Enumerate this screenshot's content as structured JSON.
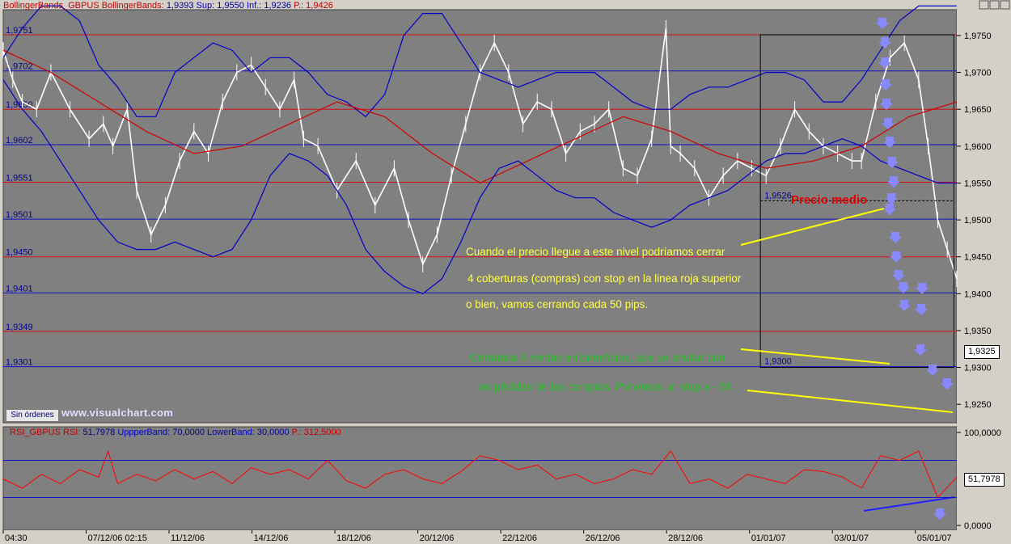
{
  "top_pane": {
    "header": {
      "name": "BollingerBands_GBPUS",
      "indicator": "BollingerBands:",
      "value": "1,9393",
      "sup_label": "Sup:",
      "sup_value": "1,9550",
      "inf_label": "Inf.:",
      "inf_value": "1,9236",
      "p_label": "P.:",
      "p_value": "1,9426"
    },
    "last_price": "1,9325",
    "order_button": "Sin órdenes",
    "watermark": "www.visualchart.com",
    "box_label_top": "1,9526",
    "box_label_bottom": "1,9300",
    "precio_medio": "Precio medio",
    "annotations": [
      "Cuando el precio llegue a este nivel podríamos cerrar",
      "4 coberturas (compras) con stop en la linea roja superior",
      "o bien, vamos cerrando cada 50 pips.",
      "Cerramos 4 ventas en beneficios, que se anulan con",
      "las pédidas de las compras. Ponemos un stop a - 50"
    ]
  },
  "bottom_pane": {
    "header": {
      "name": "RSI_GBPUS",
      "rsi_label": "RSI:",
      "rsi_value": "51,7978",
      "upper_label": "UppperBand:",
      "upper_value": "70,0000",
      "lower_label": "LowerBand:",
      "lower_value": "30,0000",
      "p_label": "P.:",
      "p_value": "312,5000"
    },
    "last_value": "51,7978"
  },
  "colors": {
    "background": "#808080",
    "blue_band": "#0000c8",
    "red_line": "#d00000",
    "yellow_line": "#ffff00",
    "annotation_yellow": "#ffff40",
    "annotation_green": "#20c020",
    "arrow": "#8888ff"
  },
  "chart_data": [
    {
      "type": "line",
      "pane": "price",
      "y_axis_ticks": [
        "1,9750",
        "1,9700",
        "1,9650",
        "1,9600",
        "1,9550",
        "1,9500",
        "1,9450",
        "1,9400",
        "1,9350",
        "1,9300",
        "1,9250"
      ],
      "ylim": [
        1.9225,
        1.9785
      ],
      "x_tick_labels": [
        "04:30",
        "07/12/06 02:15",
        "11/12/06",
        "14/12/06",
        "18/12/06",
        "20/12/06",
        "22/12/06",
        "26/12/06",
        "28/12/06",
        "01/01/07",
        "03/01/07",
        "05/01/07"
      ],
      "horizontal_levels": [
        {
          "label": "1,9751",
          "value": 1.9751,
          "color": "red"
        },
        {
          "label": "1,9702",
          "value": 1.9702,
          "color": "blue"
        },
        {
          "label": "1,9650",
          "value": 1.965,
          "color": "red"
        },
        {
          "label": "1,9602",
          "value": 1.9602,
          "color": "blue"
        },
        {
          "label": "1,9551",
          "value": 1.9551,
          "color": "red"
        },
        {
          "label": "1,9501",
          "value": 1.9501,
          "color": "blue"
        },
        {
          "label": "1,9450",
          "value": 1.945,
          "color": "red"
        },
        {
          "label": "1,9401",
          "value": 1.9401,
          "color": "blue"
        },
        {
          "label": "1,9349",
          "value": 1.9349,
          "color": "red"
        },
        {
          "label": "1,9301",
          "value": 1.9301,
          "color": "blue"
        }
      ],
      "series": [
        {
          "name": "price",
          "color": "#ffffff",
          "x": [
            0,
            0.01,
            0.02,
            0.035,
            0.05,
            0.07,
            0.09,
            0.105,
            0.115,
            0.13,
            0.14,
            0.155,
            0.17,
            0.185,
            0.2,
            0.215,
            0.23,
            0.245,
            0.26,
            0.275,
            0.29,
            0.305,
            0.315,
            0.33,
            0.35,
            0.37,
            0.39,
            0.41,
            0.425,
            0.44,
            0.455,
            0.47,
            0.485,
            0.5,
            0.515,
            0.53,
            0.545,
            0.56,
            0.575,
            0.59,
            0.605,
            0.62,
            0.635,
            0.65,
            0.665,
            0.68,
            0.695,
            0.7,
            0.71,
            0.725,
            0.74,
            0.755,
            0.77,
            0.785,
            0.8,
            0.815,
            0.83,
            0.845,
            0.86,
            0.875,
            0.89,
            0.9,
            0.915,
            0.93,
            0.945,
            0.96,
            0.97,
            0.98,
            0.99,
            1.0
          ],
          "y": [
            1.973,
            1.969,
            1.966,
            1.965,
            1.97,
            1.965,
            1.961,
            1.963,
            1.96,
            1.965,
            1.954,
            1.948,
            1.952,
            1.958,
            1.962,
            1.959,
            1.966,
            1.97,
            1.971,
            1.968,
            1.965,
            1.969,
            1.961,
            1.96,
            1.954,
            1.958,
            1.952,
            1.957,
            1.95,
            1.944,
            1.948,
            1.956,
            1.963,
            1.97,
            1.974,
            1.97,
            1.963,
            1.966,
            1.965,
            1.959,
            1.962,
            1.963,
            1.965,
            1.957,
            1.956,
            1.961,
            1.976,
            1.96,
            1.959,
            1.957,
            1.953,
            1.956,
            1.958,
            1.957,
            1.956,
            1.96,
            1.965,
            1.962,
            1.96,
            1.959,
            1.958,
            1.958,
            1.966,
            1.972,
            1.974,
            1.969,
            1.96,
            1.95,
            1.946,
            1.942
          ]
        },
        {
          "name": "upper_band",
          "color": "#0000c8",
          "x": [
            0,
            0.02,
            0.04,
            0.06,
            0.08,
            0.1,
            0.12,
            0.14,
            0.16,
            0.18,
            0.2,
            0.22,
            0.24,
            0.26,
            0.28,
            0.3,
            0.32,
            0.34,
            0.36,
            0.38,
            0.4,
            0.42,
            0.44,
            0.46,
            0.48,
            0.5,
            0.52,
            0.54,
            0.56,
            0.58,
            0.6,
            0.62,
            0.64,
            0.66,
            0.68,
            0.7,
            0.72,
            0.74,
            0.76,
            0.78,
            0.8,
            0.82,
            0.84,
            0.86,
            0.88,
            0.9,
            0.92,
            0.94,
            0.96,
            0.98,
            1.0
          ],
          "y": [
            1.972,
            1.976,
            1.979,
            1.979,
            1.977,
            1.971,
            1.968,
            1.964,
            1.964,
            1.97,
            1.972,
            1.974,
            1.973,
            1.97,
            1.972,
            1.972,
            1.97,
            1.967,
            1.966,
            1.964,
            1.967,
            1.975,
            1.978,
            1.978,
            1.974,
            1.97,
            1.969,
            1.968,
            1.969,
            1.97,
            1.97,
            1.97,
            1.968,
            1.966,
            1.965,
            1.965,
            1.967,
            1.968,
            1.968,
            1.969,
            1.97,
            1.97,
            1.969,
            1.966,
            1.966,
            1.969,
            1.973,
            1.977,
            1.979,
            1.979,
            1.979
          ]
        },
        {
          "name": "middle_band",
          "color": "#d00000",
          "x": [
            0,
            0.05,
            0.1,
            0.15,
            0.2,
            0.25,
            0.3,
            0.35,
            0.4,
            0.45,
            0.5,
            0.55,
            0.6,
            0.65,
            0.7,
            0.75,
            0.8,
            0.85,
            0.9,
            0.95,
            1.0
          ],
          "y": [
            1.973,
            1.97,
            1.966,
            1.962,
            1.959,
            1.96,
            1.963,
            1.966,
            1.964,
            1.959,
            1.955,
            1.958,
            1.961,
            1.964,
            1.962,
            1.959,
            1.957,
            1.958,
            1.96,
            1.964,
            1.966
          ]
        },
        {
          "name": "lower_band",
          "color": "#0000c8",
          "x": [
            0,
            0.02,
            0.04,
            0.06,
            0.08,
            0.1,
            0.12,
            0.14,
            0.16,
            0.18,
            0.2,
            0.22,
            0.24,
            0.26,
            0.28,
            0.3,
            0.32,
            0.34,
            0.36,
            0.38,
            0.4,
            0.42,
            0.44,
            0.46,
            0.48,
            0.5,
            0.52,
            0.54,
            0.56,
            0.58,
            0.6,
            0.62,
            0.64,
            0.66,
            0.68,
            0.7,
            0.72,
            0.74,
            0.76,
            0.78,
            0.8,
            0.82,
            0.84,
            0.86,
            0.88,
            0.9,
            0.92,
            0.94,
            0.96,
            0.98,
            1.0
          ],
          "y": [
            1.969,
            1.965,
            1.962,
            1.958,
            1.954,
            1.95,
            1.947,
            1.946,
            1.946,
            1.947,
            1.946,
            1.945,
            1.946,
            1.95,
            1.956,
            1.959,
            1.958,
            1.956,
            1.952,
            1.946,
            1.943,
            1.941,
            1.94,
            1.942,
            1.947,
            1.953,
            1.957,
            1.958,
            1.956,
            1.954,
            1.953,
            1.953,
            1.951,
            1.95,
            1.949,
            1.95,
            1.952,
            1.953,
            1.954,
            1.956,
            1.958,
            1.959,
            1.959,
            1.96,
            1.961,
            1.96,
            1.958,
            1.957,
            1.956,
            1.955,
            1.955
          ]
        }
      ]
    },
    {
      "type": "line",
      "pane": "rsi",
      "y_axis_ticks": [
        "100,0000",
        "0,0000"
      ],
      "ylim": [
        0,
        100
      ],
      "bands": [
        70,
        30
      ],
      "series": [
        {
          "name": "RSI",
          "color": "#ff0000",
          "x": [
            0,
            0.02,
            0.04,
            0.06,
            0.08,
            0.1,
            0.11,
            0.12,
            0.14,
            0.16,
            0.18,
            0.2,
            0.22,
            0.24,
            0.26,
            0.28,
            0.3,
            0.32,
            0.34,
            0.36,
            0.38,
            0.4,
            0.42,
            0.44,
            0.46,
            0.48,
            0.5,
            0.52,
            0.54,
            0.56,
            0.58,
            0.6,
            0.62,
            0.64,
            0.66,
            0.68,
            0.7,
            0.72,
            0.74,
            0.76,
            0.78,
            0.8,
            0.82,
            0.84,
            0.86,
            0.88,
            0.9,
            0.92,
            0.94,
            0.96,
            0.98,
            1.0
          ],
          "y": [
            50,
            40,
            55,
            45,
            60,
            52,
            80,
            45,
            55,
            48,
            60,
            50,
            58,
            45,
            62,
            55,
            60,
            50,
            70,
            48,
            40,
            55,
            60,
            50,
            45,
            58,
            75,
            70,
            60,
            65,
            50,
            55,
            45,
            50,
            60,
            55,
            80,
            45,
            50,
            40,
            55,
            50,
            45,
            60,
            58,
            52,
            40,
            75,
            70,
            80,
            30,
            52
          ]
        }
      ]
    }
  ]
}
